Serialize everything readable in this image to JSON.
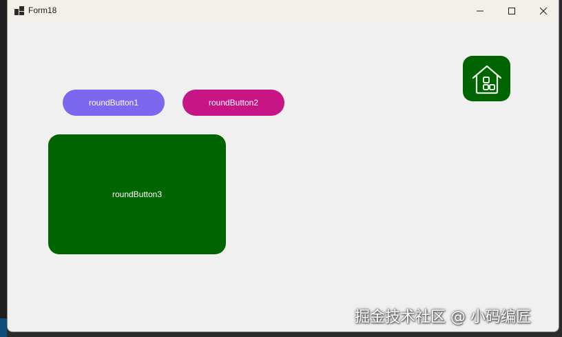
{
  "window": {
    "title": "Form18",
    "controls": {
      "minimize_icon": "minimize-icon",
      "maximize_icon": "maximize-icon",
      "close_icon": "close-icon"
    }
  },
  "buttons": [
    {
      "label": "roundButton1",
      "color": "#7b68ee"
    },
    {
      "label": "roundButton2",
      "color": "#c71585"
    },
    {
      "label": "roundButton3",
      "color": "#006400"
    }
  ],
  "home_button": {
    "icon": "home-icon",
    "color": "#006400"
  },
  "watermark": "掘金技术社区 @ 小码编匠"
}
